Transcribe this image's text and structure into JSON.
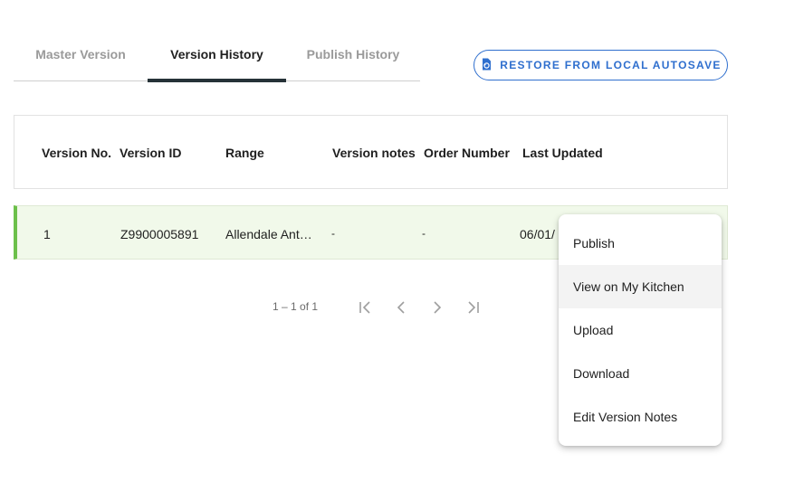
{
  "tabs": [
    {
      "label": "Master Version",
      "active": false
    },
    {
      "label": "Version History",
      "active": true
    },
    {
      "label": "Publish History",
      "active": false
    }
  ],
  "restore_button": {
    "label": "RESTORE FROM LOCAL AUTOSAVE",
    "icon": "restore-file-icon",
    "color": "#2f6fce"
  },
  "table": {
    "headers": [
      "Version No.",
      "Version ID",
      "Range",
      "Version notes",
      "Order Number",
      "Last Updated"
    ],
    "rows": [
      {
        "version_no": "1",
        "version_id": "Z9900005891",
        "range": "Allendale Anti…",
        "version_notes": "-",
        "order_number": "-",
        "last_updated": "06/01/"
      }
    ],
    "selected_row_accent": "#6cc04a"
  },
  "pagination": {
    "range_label": "1 – 1 of 1",
    "icons": [
      "first-page-icon",
      "previous-page-icon",
      "next-page-icon",
      "last-page-icon"
    ]
  },
  "context_menu": {
    "items": [
      "Publish",
      "View on My Kitchen",
      "Upload",
      "Download",
      "Edit Version Notes"
    ],
    "hovered_item": "View on My Kitchen"
  }
}
